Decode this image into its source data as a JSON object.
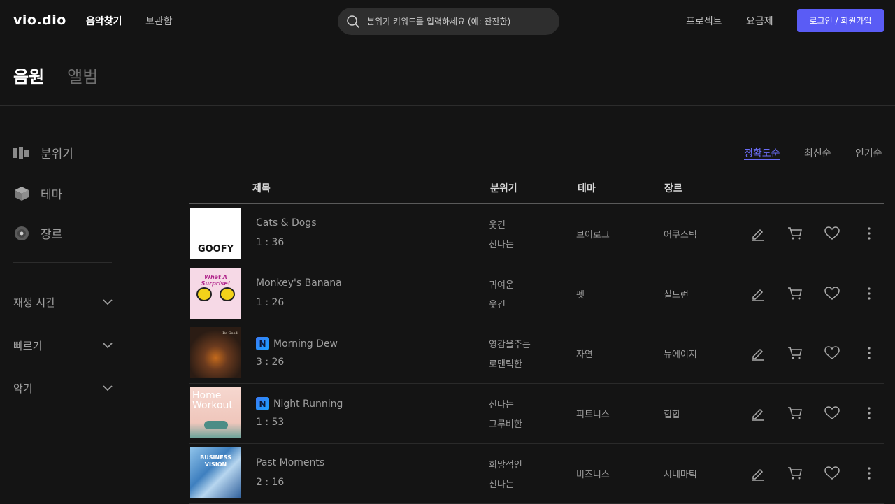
{
  "header": {
    "logo": "vio.dio",
    "nav": [
      "음악찾기",
      "보관함"
    ],
    "search_placeholder": "분위기 키워드를 입력하세요 (예: 잔잔한)",
    "right_links": [
      "프로젝트",
      "요금제"
    ],
    "login_label": "로그인 / 회원가입"
  },
  "page_tabs": [
    "음원",
    "앨범"
  ],
  "sidebar": {
    "categories": [
      "분위기",
      "테마",
      "장르"
    ],
    "filters": [
      "재생 시간",
      "빠르기",
      "악기"
    ]
  },
  "sort_options": [
    "정확도순",
    "최신순",
    "인기순"
  ],
  "table": {
    "columns": [
      "제목",
      "분위기",
      "테마",
      "장르"
    ],
    "rows": [
      {
        "title": "Cats & Dogs",
        "duration": "1 : 36",
        "moods": [
          "웃긴",
          "신나는"
        ],
        "theme": "브이로그",
        "genre": "어쿠스틱",
        "badge": "",
        "thumb_text": "GOOFY"
      },
      {
        "title": "Monkey's Banana",
        "duration": "1 : 26",
        "moods": [
          "귀여운",
          "웃긴"
        ],
        "theme": "펫",
        "genre": "칠드런",
        "badge": "",
        "thumb_text": "What A Surprise!"
      },
      {
        "title": "Morning Dew",
        "duration": "3 : 26",
        "moods": [
          "영감을주는",
          "로맨틱한"
        ],
        "theme": "자연",
        "genre": "뉴에이지",
        "badge": "N",
        "thumb_text": "Be Good"
      },
      {
        "title": "Night Running",
        "duration": "1 : 53",
        "moods": [
          "신나는",
          "그루비한"
        ],
        "theme": "피트니스",
        "genre": "힙합",
        "badge": "N",
        "thumb_text": "Home Workout"
      },
      {
        "title": "Past Moments",
        "duration": "2 : 16",
        "moods": [
          "희망적인",
          "신나는"
        ],
        "theme": "비즈니스",
        "genre": "시네마틱",
        "badge": "",
        "thumb_text": "BUSINESS VISION"
      }
    ]
  },
  "colors": {
    "accent": "#5a5cf5",
    "sort_active": "#6b6df7",
    "bg": "#141414"
  }
}
